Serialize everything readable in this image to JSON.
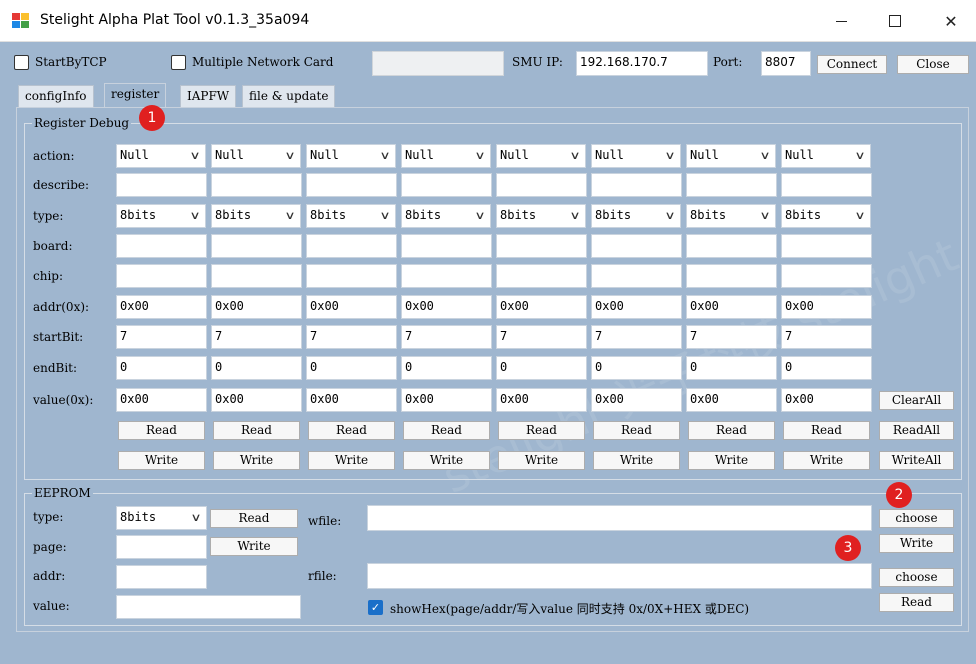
{
  "window": {
    "title": "Stelight Alpha Plat Tool v0.1.3_35a094",
    "icon": "app-icon",
    "controls": {
      "minimize": "minimize-icon",
      "maximize": "maximize-icon",
      "close": "✕"
    }
  },
  "toolbar": {
    "start_by_tcp": {
      "label": "StartByTCP",
      "checked": false
    },
    "multi_nic": {
      "label": "Multiple Network Card",
      "checked": false
    },
    "nic_value": "",
    "smu_ip_label": "SMU IP:",
    "smu_ip_value": "192.168.170.7",
    "port_label": "Port:",
    "port_value": "8807",
    "connect_label": "Connect",
    "close_label": "Close"
  },
  "tabs": [
    {
      "label": "configInfo",
      "active": false
    },
    {
      "label": "register",
      "active": true
    },
    {
      "label": "IAPFW",
      "active": false
    },
    {
      "label": "file & update",
      "active": false
    }
  ],
  "register_debug": {
    "title": "Register Debug",
    "row_labels": {
      "action": "action:",
      "describe": "describe:",
      "type": "type:",
      "board": "board:",
      "chip": "chip:",
      "addr": "addr(0x):",
      "startBit": "startBit:",
      "endBit": "endBit:",
      "value": "value(0x):"
    },
    "columns": [
      {
        "action": "Null",
        "describe": "",
        "type": "8bits",
        "board": "",
        "chip": "",
        "addr": "0x00",
        "startBit": "7",
        "endBit": "0",
        "value": "0x00",
        "read": "Read",
        "write": "Write"
      },
      {
        "action": "Null",
        "describe": "",
        "type": "8bits",
        "board": "",
        "chip": "",
        "addr": "0x00",
        "startBit": "7",
        "endBit": "0",
        "value": "0x00",
        "read": "Read",
        "write": "Write"
      },
      {
        "action": "Null",
        "describe": "",
        "type": "8bits",
        "board": "",
        "chip": "",
        "addr": "0x00",
        "startBit": "7",
        "endBit": "0",
        "value": "0x00",
        "read": "Read",
        "write": "Write"
      },
      {
        "action": "Null",
        "describe": "",
        "type": "8bits",
        "board": "",
        "chip": "",
        "addr": "0x00",
        "startBit": "7",
        "endBit": "0",
        "value": "0x00",
        "read": "Read",
        "write": "Write"
      },
      {
        "action": "Null",
        "describe": "",
        "type": "8bits",
        "board": "",
        "chip": "",
        "addr": "0x00",
        "startBit": "7",
        "endBit": "0",
        "value": "0x00",
        "read": "Read",
        "write": "Write"
      },
      {
        "action": "Null",
        "describe": "",
        "type": "8bits",
        "board": "",
        "chip": "",
        "addr": "0x00",
        "startBit": "7",
        "endBit": "0",
        "value": "0x00",
        "read": "Read",
        "write": "Write"
      },
      {
        "action": "Null",
        "describe": "",
        "type": "8bits",
        "board": "",
        "chip": "",
        "addr": "0x00",
        "startBit": "7",
        "endBit": "0",
        "value": "0x00",
        "read": "Read",
        "write": "Write"
      },
      {
        "action": "Null",
        "describe": "",
        "type": "8bits",
        "board": "",
        "chip": "",
        "addr": "0x00",
        "startBit": "7",
        "endBit": "0",
        "value": "0x00",
        "read": "Read",
        "write": "Write"
      }
    ],
    "clear_all": "ClearAll",
    "read_all": "ReadAll",
    "write_all": "WriteAll"
  },
  "eeprom": {
    "title": "EEPROM",
    "type_label": "type:",
    "type_value": "8bits",
    "page_label": "page:",
    "page_value": "",
    "addr_label": "addr:",
    "addr_value": "",
    "value_label": "value:",
    "value_value": "",
    "read_label": "Read",
    "write_label": "Write",
    "wfile_label": "wfile:",
    "wfile_value": "",
    "rfile_label": "rfile:",
    "rfile_value": "",
    "choose_w": "choose",
    "write_file": "Write",
    "choose_r": "choose",
    "read_file": "Read",
    "show_hex_label": "showHex(page/addr/写入value 同时支持 0x/0X+HEX 或DEC)",
    "show_hex_checked": true
  },
  "annotations": [
    "1",
    "2",
    "3"
  ],
  "colors": {
    "accent": "#1a6fc9",
    "badge": "#e02020",
    "panel": "#9fb6cf"
  }
}
